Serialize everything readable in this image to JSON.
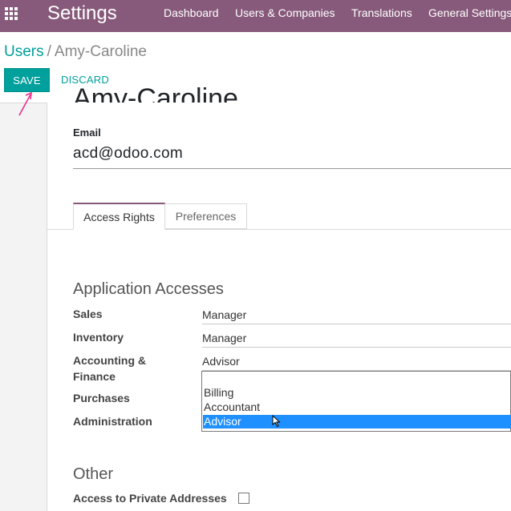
{
  "navbar": {
    "app_title": "Settings",
    "menu": [
      "Dashboard",
      "Users & Companies",
      "Translations",
      "General Settings"
    ]
  },
  "breadcrumb": {
    "parent": "Users",
    "separator": "/",
    "current": "Amy-Caroline"
  },
  "toolbar": {
    "save_label": "SAVE",
    "discard_label": "DISCARD"
  },
  "form": {
    "name": "Amy-Caroline",
    "email_label": "Email",
    "email_value": "acd@odoo.com"
  },
  "tabs": [
    {
      "label": "Access Rights",
      "active": true
    },
    {
      "label": "Preferences",
      "active": false
    }
  ],
  "application_accesses": {
    "title": "Application Accesses",
    "fields": [
      {
        "label": "Sales",
        "value": "Manager"
      },
      {
        "label": "Inventory",
        "value": "Manager"
      },
      {
        "label": "Accounting &\nFinance",
        "value": "Advisor"
      },
      {
        "label": "Purchases",
        "value": ""
      },
      {
        "label": "Administration",
        "value": ""
      }
    ],
    "dropdown_options": [
      "",
      "Billing",
      "Accountant",
      "Advisor"
    ],
    "dropdown_selected": "Advisor"
  },
  "other": {
    "title": "Other",
    "private_addresses_label": "Access to Private Addresses",
    "private_addresses_checked": false
  },
  "colors": {
    "navbar": "#875a7b",
    "primary": "#00a09d",
    "selection": "#1e90ff"
  }
}
